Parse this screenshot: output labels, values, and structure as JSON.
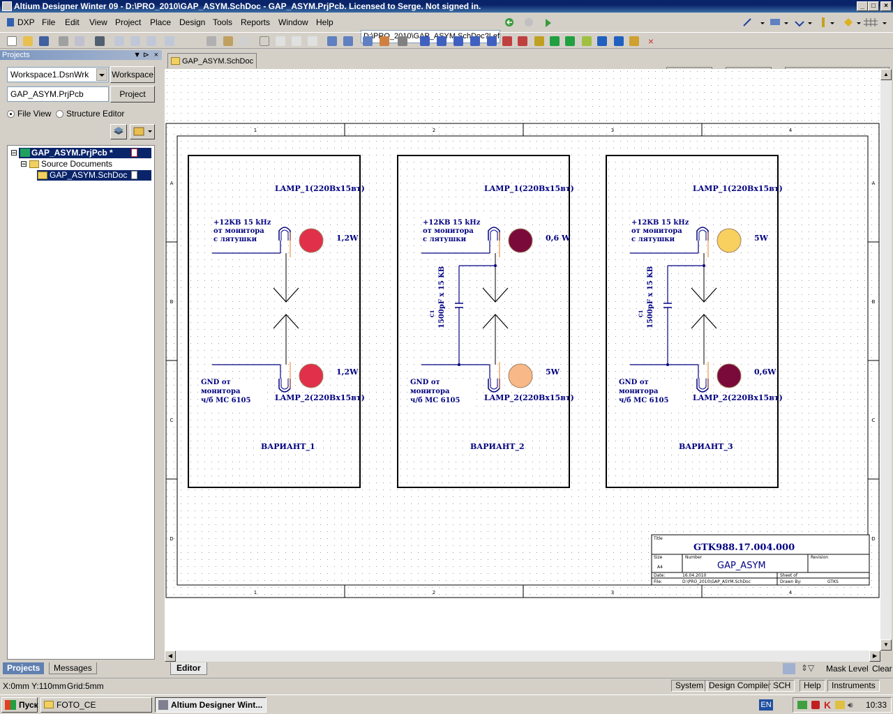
{
  "window": {
    "title": "Altium Designer Winter 09 - D:\\PRO_2010\\GAP_ASYM.SchDoc - GAP_ASYM.PrjPcb. Licensed to Serge. Not signed in."
  },
  "menu": [
    "DXP",
    "File",
    "Edit",
    "View",
    "Project",
    "Place",
    "Design",
    "Tools",
    "Reports",
    "Window",
    "Help"
  ],
  "path_combo": "D:\\PRO_2010\\GAP_ASYM.SchDoc?Lef",
  "panel": {
    "title": "Projects",
    "workspace": "Workspace1.DsnWrk",
    "workspace_btn": "Workspace",
    "project": "GAP_ASYM.PrjPcb",
    "project_btn": "Project",
    "radio_file": "File View",
    "radio_struct": "Structure Editor",
    "tree": {
      "project": "GAP_ASYM.PrjPcb *",
      "folder": "Source Documents",
      "doc": "GAP_ASYM.SchDoc"
    },
    "tabs": [
      "Projects",
      "Messages"
    ]
  },
  "doc_tab": "GAP_ASYM.SchDoc",
  "editor_tab": "Editor",
  "schematic": {
    "zone_cols": [
      "1",
      "2",
      "3",
      "4"
    ],
    "zone_rows": [
      "A",
      "B",
      "C",
      "D"
    ],
    "variants": [
      {
        "lamp1": "LAMP_1(220Вх15вт)",
        "lamp2": "LAMP_2(220Вх15вт)",
        "src": [
          "+12KB 15 kHz",
          "от монитора",
          "с лятушки"
        ],
        "gnd": [
          "GND от",
          "монитора",
          "ч/б МС 6105"
        ],
        "w_top": "1,2W",
        "w_bot": "1,2W",
        "c_top": "#e0304a",
        "c_bot": "#e0304a",
        "label": "ВАРИАНТ_1",
        "cap": false
      },
      {
        "lamp1": "LAMP_1(220Вх15вт)",
        "lamp2": "LAMP_2(220Вх15вт)",
        "src": [
          "+12KB 15 kHz",
          "от монитора",
          "с лятушки"
        ],
        "gnd": [
          "GND от",
          "монитора",
          "ч/б МС 6105"
        ],
        "w_top": "0,6 W",
        "w_bot": "5W",
        "c_top": "#7a0a3a",
        "c_bot": "#f8b888",
        "label": "ВАРИАНТ_2",
        "cap": true,
        "cap_ref": "C1",
        "cap_val": "1500pF x 15 KB"
      },
      {
        "lamp1": "LAMP_1(220Вх15вт)",
        "lamp2": "LAMP_2(220Вх15вт)",
        "src": [
          "+12KB 15 kHz",
          "от монитора",
          "с лятушки"
        ],
        "gnd": [
          "GND от",
          "монитора",
          "ч/б МС 6105"
        ],
        "w_top": "5W",
        "w_bot": "0,6W",
        "c_top": "#f8d060",
        "c_bot": "#7a0a3a",
        "label": "ВАРИАНТ_3",
        "cap": true,
        "cap_ref": "C1",
        "cap_val": "1500pF x 15 KB"
      }
    ],
    "titleblock": {
      "title_lbl": "Title",
      "title": "GTK988.17.004.000",
      "size_lbl": "Size",
      "size": "A4",
      "number_lbl": "Number",
      "number": "GAP_ASYM",
      "revision_lbl": "Revision",
      "date_lbl": "Date:",
      "date": "16.04.2010",
      "sheet_lbl": "Sheet   of",
      "file_lbl": "File:",
      "file": "D:\\PRO_2010\\GAP_ASYM.SchDoc",
      "drawn_lbl": "Drawn By:",
      "drawn": "GTKS"
    }
  },
  "editor_right": {
    "mask": "Mask Level",
    "clear": "Clear"
  },
  "status": {
    "coords": "X:0mm Y:110mm",
    "grid": "Grid:5mm",
    "panels": [
      "System",
      "Design Compiler",
      "SCH",
      "Help",
      "Instruments"
    ]
  },
  "taskbar": {
    "start": "Пуск",
    "tasks": [
      "FOTO_CE",
      "Altium Designer Wint..."
    ],
    "lang": "EN",
    "clock": "10:33"
  }
}
